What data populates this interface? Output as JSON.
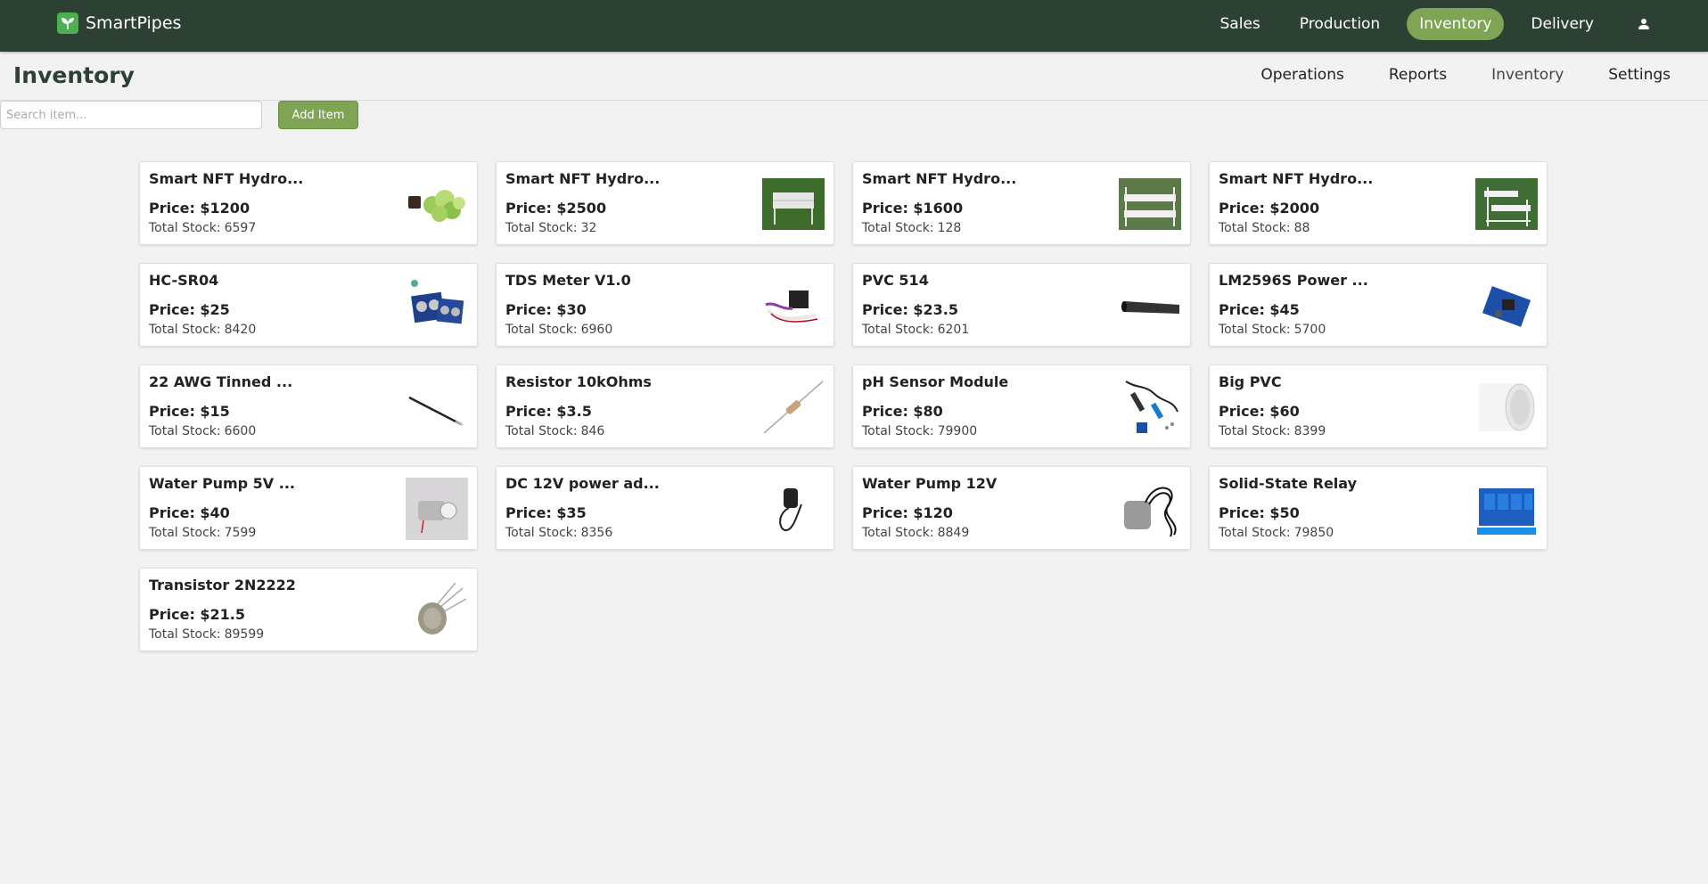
{
  "app": {
    "name": "SmartPipes"
  },
  "topnav": {
    "items": [
      {
        "label": "Sales"
      },
      {
        "label": "Production"
      },
      {
        "label": "Inventory",
        "active": true
      },
      {
        "label": "Delivery"
      }
    ]
  },
  "page": {
    "title": "Inventory"
  },
  "subnav": {
    "items": [
      {
        "label": "Operations"
      },
      {
        "label": "Reports"
      },
      {
        "label": "Inventory"
      },
      {
        "label": "Settings"
      }
    ]
  },
  "toolbar": {
    "search_placeholder": "Search item...",
    "add_label": "Add Item"
  },
  "stock_label": "Total Stock:",
  "items": [
    {
      "name": "Smart NFT Hydro...",
      "price": "Price: $1200",
      "stock": "6597",
      "icon": "lettuce-kit-icon"
    },
    {
      "name": "Smart NFT Hydro...",
      "price": "Price: $2500",
      "stock": "32",
      "icon": "hydroponic-table-icon"
    },
    {
      "name": "Smart NFT Hydro...",
      "price": "Price: $1600",
      "stock": "128",
      "icon": "hydroponic-rack-icon"
    },
    {
      "name": "Smart NFT Hydro...",
      "price": "Price: $2000",
      "stock": "88",
      "icon": "hydroponic-tiered-rack-icon"
    },
    {
      "name": "HC-SR04",
      "price": "Price: $25",
      "stock": "8420",
      "icon": "ultrasonic-sensor-icon"
    },
    {
      "name": "TDS Meter V1.0",
      "price": "Price: $30",
      "stock": "6960",
      "icon": "tds-meter-icon"
    },
    {
      "name": "PVC 514",
      "price": "Price: $23.5",
      "stock": "6201",
      "icon": "pvc-pipe-icon"
    },
    {
      "name": "LM2596S Power ...",
      "price": "Price: $45",
      "stock": "5700",
      "icon": "power-module-icon"
    },
    {
      "name": "22 AWG Tinned ...",
      "price": "Price: $15",
      "stock": "6600",
      "icon": "wire-icon"
    },
    {
      "name": "Resistor 10kOhms",
      "price": "Price: $3.5",
      "stock": "846",
      "icon": "resistor-icon"
    },
    {
      "name": "pH Sensor Module",
      "price": "Price: $80",
      "stock": "79900",
      "icon": "ph-sensor-icon"
    },
    {
      "name": "Big PVC",
      "price": "Price: $60",
      "stock": "8399",
      "icon": "big-pvc-icon"
    },
    {
      "name": "Water Pump 5V ...",
      "price": "Price: $40",
      "stock": "7599",
      "icon": "mini-pump-icon"
    },
    {
      "name": "DC 12V power ad...",
      "price": "Price: $35",
      "stock": "8356",
      "icon": "power-adapter-icon"
    },
    {
      "name": "Water Pump 12V",
      "price": "Price: $120",
      "stock": "8849",
      "icon": "water-pump-icon"
    },
    {
      "name": "Solid-State Relay",
      "price": "Price: $50",
      "stock": "79850",
      "icon": "relay-board-icon"
    },
    {
      "name": "Transistor 2N2222",
      "price": "Price: $21.5",
      "stock": "89599",
      "icon": "transistor-icon"
    }
  ],
  "colors": {
    "nav_bg": "#2c4133",
    "accent": "#7fa454",
    "page_bg": "#f2f2f2"
  }
}
